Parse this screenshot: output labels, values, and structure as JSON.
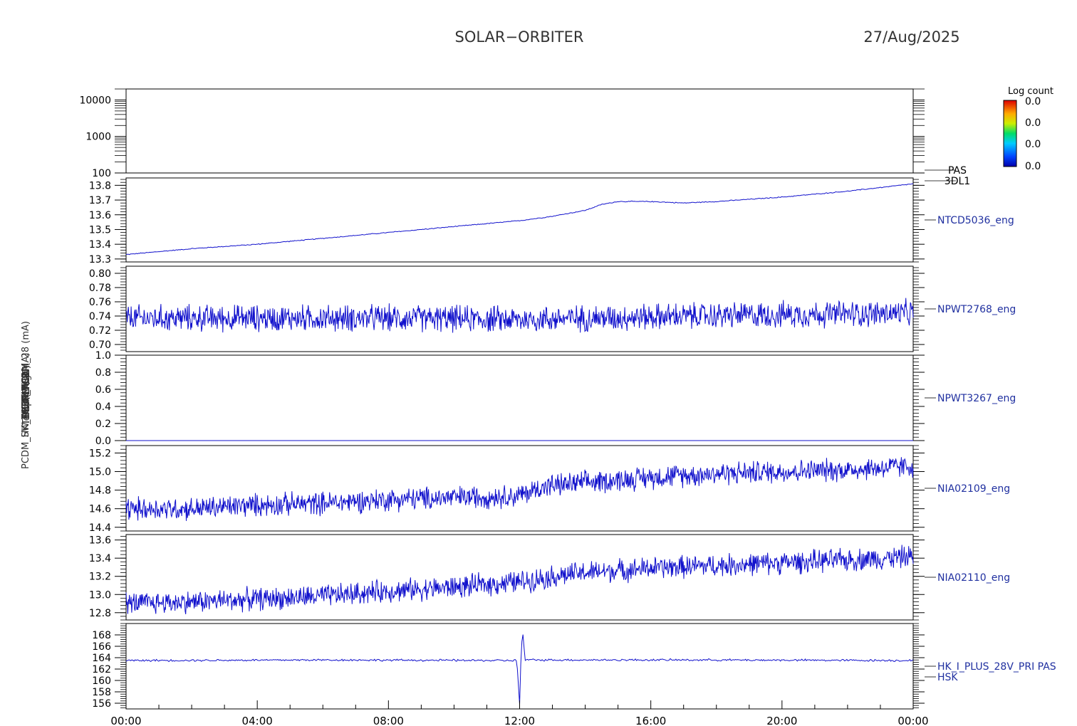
{
  "header": {
    "title": "SOLAR−ORBITER",
    "date": "27/Aug/2025"
  },
  "colorbar": {
    "label": "Log count",
    "ticks": [
      "0.0",
      "0.0",
      "0.0",
      "0.0"
    ]
  },
  "colors": {
    "trace": "#1010cc",
    "label": "#2030a0",
    "axis": "#000000"
  },
  "chart_data": [
    {
      "type": "heatmap",
      "panel_id": "pas",
      "ylabel": "E (eV)",
      "yscale": "log",
      "ylim": [
        100,
        20000
      ],
      "yticks": [
        100,
        1000,
        10000
      ],
      "ytick_labels": [
        "100",
        "1000",
        "10000"
      ],
      "right_label": [
        "PAS",
        "3DL1"
      ],
      "values": []
    },
    {
      "type": "line",
      "panel_id": "ntcd5036",
      "ylabel": "Temp (DegC)",
      "ylim": [
        13.28,
        13.85
      ],
      "yticks": [
        13.3,
        13.4,
        13.5,
        13.6,
        13.7,
        13.8
      ],
      "ytick_labels": [
        "13.3",
        "13.4",
        "13.5",
        "13.6",
        "13.7",
        "13.8"
      ],
      "right_label": [
        "NTCD5036_eng"
      ],
      "series": [
        {
          "x": [
            "00:00",
            "02:00",
            "04:00",
            "06:00",
            "08:00",
            "10:00",
            "12:00",
            "13:00",
            "14:00",
            "14:30",
            "15:00",
            "16:00",
            "17:00",
            "18:00",
            "20:00",
            "22:00",
            "24:00"
          ],
          "y": [
            13.33,
            13.37,
            13.4,
            13.44,
            13.48,
            13.52,
            13.56,
            13.59,
            13.63,
            13.67,
            13.69,
            13.69,
            13.68,
            13.69,
            13.72,
            13.76,
            13.81
          ],
          "noise": 0.005
        }
      ]
    },
    {
      "type": "line",
      "panel_id": "npwt2768",
      "ylabel": "SW FOUT MON (A)",
      "ylim": [
        0.69,
        0.81
      ],
      "yticks": [
        0.7,
        0.72,
        0.74,
        0.76,
        0.78,
        0.8
      ],
      "ytick_labels": [
        "0.70",
        "0.72",
        "0.74",
        "0.76",
        "0.78",
        "0.80"
      ],
      "right_label": [
        "NPWT2768_eng"
      ],
      "series": [
        {
          "x": [
            "00:00",
            "04:00",
            "08:00",
            "12:00",
            "16:00",
            "20:00",
            "24:00"
          ],
          "y": [
            0.737,
            0.737,
            0.737,
            0.735,
            0.739,
            0.742,
            0.744
          ],
          "noise": 0.03
        }
      ]
    },
    {
      "type": "line",
      "panel_id": "npwt3267",
      "ylabel": "SWA EAS1",
      "ylim": [
        0.0,
        1.0
      ],
      "yticks": [
        0.0,
        0.2,
        0.4,
        0.6,
        0.8,
        1.0
      ],
      "ytick_labels": [
        "0.0",
        "0.2",
        "0.4",
        "0.6",
        "0.8",
        "1.0"
      ],
      "right_label": [
        "NPWT3267_eng"
      ],
      "series": [
        {
          "x": [
            "00:00",
            "24:00"
          ],
          "y": [
            0.0,
            0.0
          ],
          "noise": 0
        }
      ]
    },
    {
      "type": "line",
      "panel_id": "nia02109",
      "ylabel": "THERM CA",
      "ylim": [
        14.36,
        15.28
      ],
      "yticks": [
        14.4,
        14.6,
        14.8,
        15.0,
        15.2
      ],
      "ytick_labels": [
        "14.4",
        "14.6",
        "14.8",
        "15.0",
        "15.2"
      ],
      "right_label": [
        "NIA02109_eng"
      ],
      "series": [
        {
          "x": [
            "00:00",
            "02:00",
            "04:00",
            "06:00",
            "08:00",
            "10:00",
            "12:00",
            "12:45",
            "14:00",
            "16:00",
            "18:00",
            "20:00",
            "22:00",
            "24:00"
          ],
          "y": [
            14.6,
            14.6,
            14.64,
            14.66,
            14.7,
            14.72,
            14.74,
            14.84,
            14.88,
            14.94,
            14.98,
            15.0,
            15.02,
            15.06
          ],
          "noise": 0.2
        }
      ]
    },
    {
      "type": "line",
      "panel_id": "nia02110",
      "ylabel": "THERM MIRR",
      "ylim": [
        12.72,
        13.66
      ],
      "yticks": [
        12.8,
        13.0,
        13.2,
        13.4,
        13.6
      ],
      "ytick_labels": [
        "12.8",
        "13.0",
        "13.2",
        "13.4",
        "13.6"
      ],
      "right_label": [
        "NIA02110_eng"
      ],
      "series": [
        {
          "x": [
            "00:00",
            "02:00",
            "04:00",
            "06:00",
            "08:00",
            "10:00",
            "12:00",
            "13:00",
            "14:00",
            "16:00",
            "18:00",
            "20:00",
            "22:00",
            "24:00"
          ],
          "y": [
            12.9,
            12.92,
            12.95,
            12.98,
            13.04,
            13.08,
            13.14,
            13.2,
            13.24,
            13.29,
            13.32,
            13.35,
            13.38,
            13.42
          ],
          "noise": 0.2
        }
      ]
    },
    {
      "type": "line",
      "panel_id": "hk_i_plus",
      "ylabel": "PCDM_HK_IMON_PCDM_28 (mA)",
      "ylim": [
        155,
        170
      ],
      "yticks": [
        156,
        158,
        160,
        162,
        164,
        166,
        168
      ],
      "ytick_labels": [
        "156",
        "158",
        "160",
        "162",
        "164",
        "166",
        "168"
      ],
      "right_label": [
        "HK_I_PLUS_28V_PRI PAS",
        "HSK"
      ],
      "series": [
        {
          "x": [
            "00:00",
            "06:00",
            "11:55",
            "12:00",
            "12:03",
            "12:06",
            "12:10",
            "18:00",
            "24:00"
          ],
          "y": [
            163.5,
            163.6,
            163.5,
            155.8,
            166.0,
            168.2,
            163.6,
            163.6,
            163.5
          ],
          "noise": 0.3
        }
      ]
    }
  ],
  "xaxis": {
    "tick_labels": [
      "00:00",
      "04:00",
      "08:00",
      "12:00",
      "16:00",
      "20:00",
      "00:00"
    ],
    "range_hours": [
      0,
      24
    ]
  }
}
